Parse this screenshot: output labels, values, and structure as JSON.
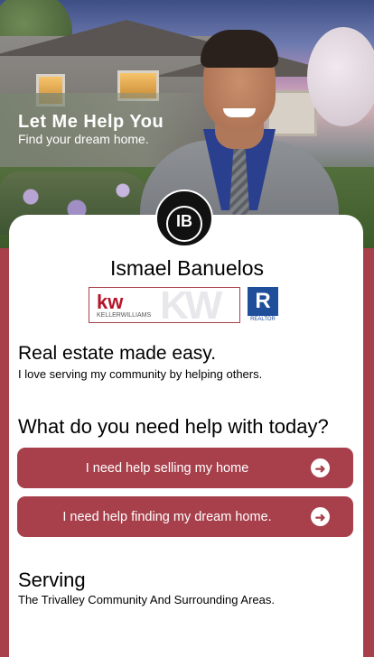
{
  "hero": {
    "title": "Let Me Help You",
    "subtitle": "Find your dream home."
  },
  "profile": {
    "logo_text": "IB",
    "name": "Ismael Banuelos"
  },
  "badges": {
    "brokerage_mark": "kw",
    "brokerage_name": "KELLERWILLIAMS",
    "brokerage_watermark": "KW",
    "realtor_mark": "R",
    "realtor_label": "REALTOR"
  },
  "intro": {
    "heading": "Real estate made easy.",
    "text": "I love serving my community by helping others."
  },
  "help": {
    "heading": "What do you need help with today?",
    "buttons": [
      {
        "label": "I need help selling my home",
        "icon": "arrow-right-icon"
      },
      {
        "label": "I need help finding my dream home.",
        "icon": "arrow-right-icon"
      }
    ]
  },
  "serving": {
    "heading": "Serving",
    "text": "The Trivalley Community And Surrounding Areas."
  },
  "colors": {
    "accent": "#a8404c",
    "card": "#ffffff"
  }
}
